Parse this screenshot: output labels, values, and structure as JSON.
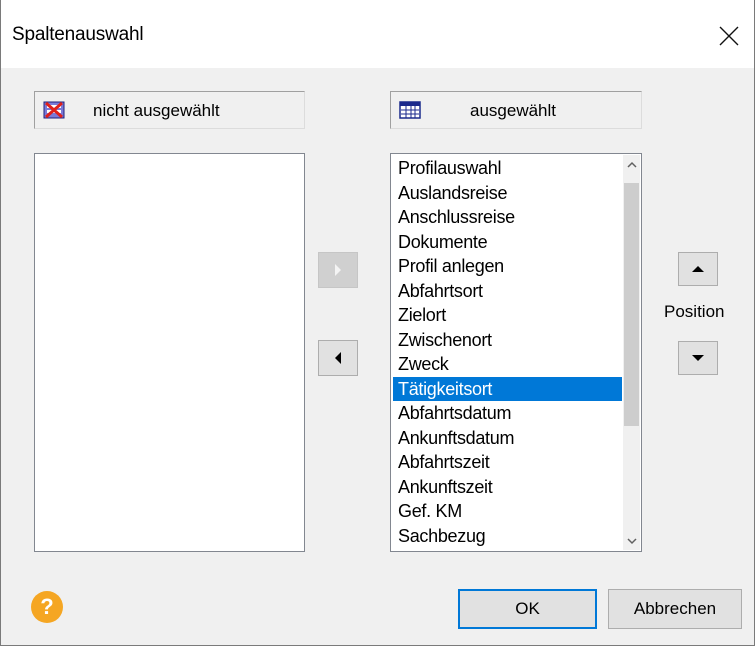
{
  "window": {
    "title": "Spaltenauswahl",
    "close_glyph": "✕"
  },
  "left_panel": {
    "header_label": "nicht ausgewählt",
    "header_icon": "columns-removed-icon",
    "items": []
  },
  "right_panel": {
    "header_label": "ausgewählt",
    "header_icon": "columns-table-icon",
    "items": [
      "Profilauswahl",
      "Auslandsreise",
      "Anschlussreise",
      "Dokumente",
      "Profil anlegen",
      "Abfahrtsort",
      "Zielort",
      "Zwischenort",
      "Zweck",
      "Tätigkeitsort",
      "Abfahrtsdatum",
      "Ankunftsdatum",
      "Abfahrtszeit",
      "Ankunftszeit",
      "Gef. KM",
      "Sachbezug"
    ],
    "selected_item": "Tätigkeitsort",
    "selected_index": 9
  },
  "move_buttons": {
    "add_icon": "arrow-right-icon",
    "remove_icon": "arrow-left-icon",
    "add_enabled": false
  },
  "position": {
    "label": "Position",
    "up_icon": "arrow-up-icon",
    "down_icon": "arrow-down-icon"
  },
  "footer": {
    "help_glyph": "?",
    "ok_label": "OK",
    "cancel_label": "Abbrechen"
  },
  "colors": {
    "selection": "#0078d7",
    "help": "#f5a623",
    "dialog_bg": "#f0f0f0"
  }
}
